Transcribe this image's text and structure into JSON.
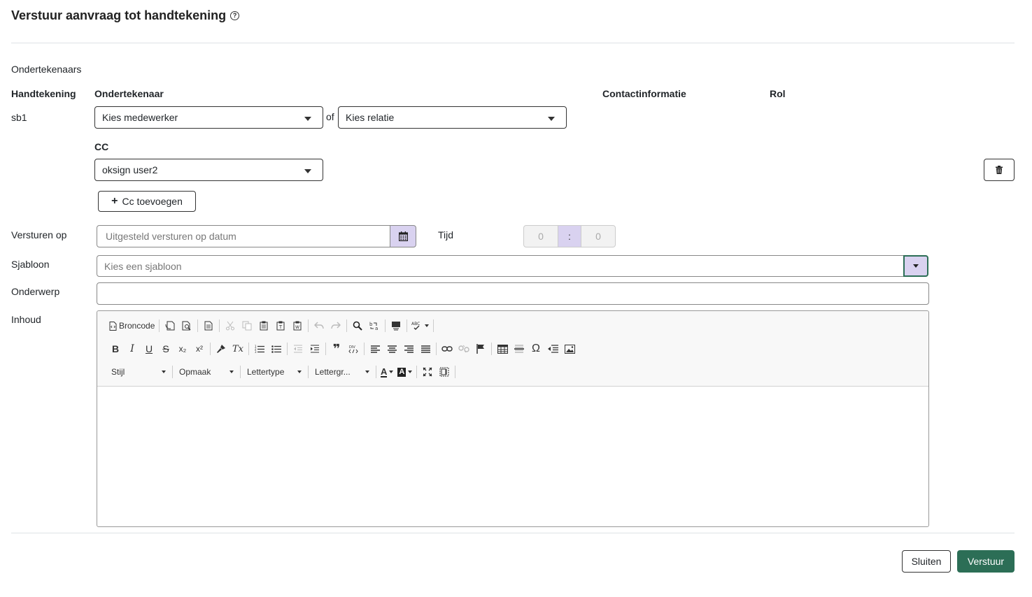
{
  "dialog": {
    "title": "Verstuur aanvraag tot handtekening",
    "help_icon": "?"
  },
  "signers": {
    "section_label": "Ondertekenaars",
    "headers": {
      "signature": "Handtekening",
      "signer": "Ondertekenaar",
      "contact": "Contactinformatie",
      "role": "Rol"
    },
    "rows": [
      {
        "signature": "sb1",
        "employee_select": "Kies medewerker",
        "or_label": "of",
        "relation_select": "Kies relatie"
      }
    ],
    "cc_label": "CC",
    "cc_value": "oksign user2",
    "add_cc_label": "Cc toevoegen",
    "add_cc_icon": "+"
  },
  "form": {
    "send_on_label": "Versturen op",
    "send_on_placeholder": "Uitgesteld versturen op datum",
    "time_label": "Tijd",
    "time_hours": "0",
    "time_sep": ":",
    "time_minutes": "0",
    "template_label": "Sjabloon",
    "template_placeholder": "Kies een sjabloon",
    "subject_label": "Onderwerp",
    "subject_value": "",
    "content_label": "Inhoud"
  },
  "editor": {
    "source_label": "Broncode",
    "style_combo": "Stijl",
    "format_combo": "Opmaak",
    "font_combo": "Lettertype",
    "size_combo": "Lettergr...",
    "glyphs": {
      "bold": "B",
      "italic": "I",
      "underline": "U",
      "strike": "S",
      "subscript": "x₂",
      "superscript": "x²",
      "removeformat": "Tx",
      "quote": "❞",
      "omega": "Ω",
      "textcolor": "A",
      "bgcolor": "A"
    }
  },
  "footer": {
    "close_label": "Sluiten",
    "send_label": "Verstuur"
  },
  "colors": {
    "primary": "#2c6e56",
    "accent_light": "#d9d2f0"
  }
}
